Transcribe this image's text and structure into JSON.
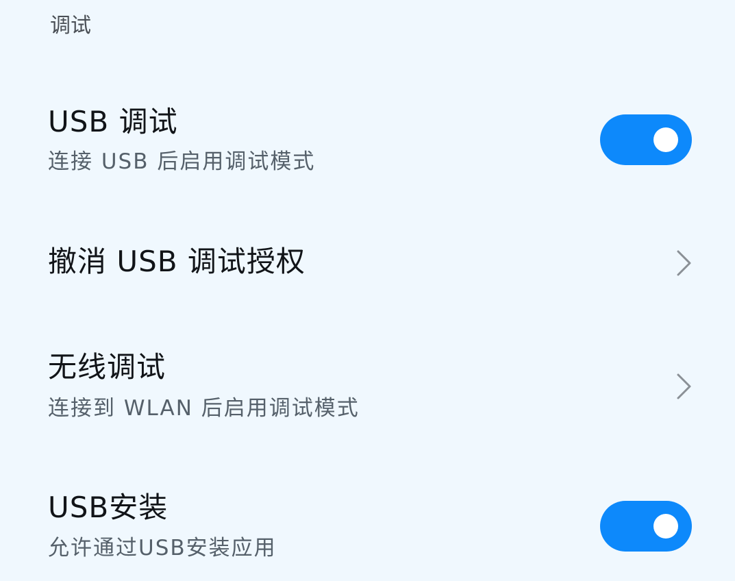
{
  "section": {
    "header": "调试"
  },
  "items": [
    {
      "title": "USB 调试",
      "subtitle": "连接 USB 后启用调试模式",
      "control": "toggle",
      "on": true
    },
    {
      "title": "撤消 USB 调试授权",
      "control": "chevron"
    },
    {
      "title": "无线调试",
      "subtitle": "连接到 WLAN 后启用调试模式",
      "control": "chevron"
    },
    {
      "title": "USB安装",
      "subtitle": "允许通过USB安装应用",
      "control": "toggle",
      "on": true
    }
  ],
  "colors": {
    "background": "#f0f8fe",
    "accent": "#0d89fb",
    "title": "#111418",
    "subtitle": "#55606a",
    "chevron": "#8a9096"
  },
  "icons": {
    "chevron": "chevron-right-icon"
  }
}
